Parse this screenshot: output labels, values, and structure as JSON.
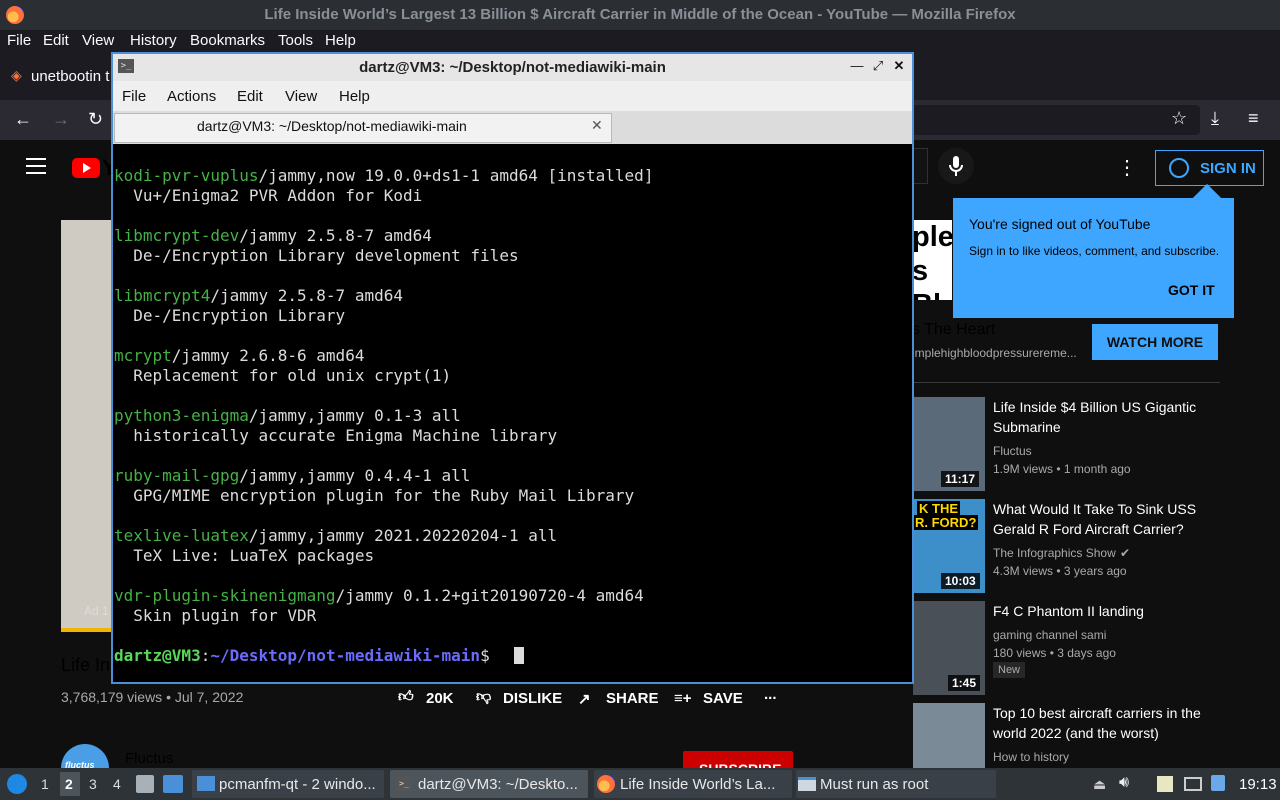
{
  "firefox": {
    "window_title": "Life Inside World’s Largest 13 Billion $ Aircraft Carrier in Middle of the Ocean - YouTube — Mozilla Firefox",
    "menu": [
      "File",
      "Edit",
      "View",
      "History",
      "Bookmarks",
      "Tools",
      "Help"
    ],
    "tab_label": "unetbootin t"
  },
  "youtube": {
    "logo_partial": "Y",
    "sign_in": "SIGN IN",
    "ad_label": "Ad 1",
    "video_title_partial": "Life In",
    "views": "3,768,179 views • Jul 7, 2022",
    "actions": {
      "like": "20K",
      "dislike": "DISLIKE",
      "share": "SHARE",
      "save": "SAVE",
      "more": "..."
    },
    "channel": "Fluctus",
    "avatar_text": "fluctus",
    "subscribe": "SUBSCRIBE",
    "ad": {
      "thumb_line1": "ple",
      "thumb_line2": "s Bl",
      "text": "s The Heart",
      "url": "implehighbloodpressureremе...",
      "button": "WATCH MORE"
    },
    "tooltip": {
      "title": "You're signed out of YouTube",
      "body": "Sign in to like videos, comment, and subscribe.",
      "button": "GOT IT"
    },
    "suggestions": [
      {
        "title": "Life Inside $4 Billion US Gigantic Submarine",
        "channel": "Fluctus",
        "meta": "1.9M views • 1 month ago",
        "duration": "11:17",
        "thumb_color": "#5a6a78"
      },
      {
        "title": "What Would It Take To Sink USS Gerald R Ford Aircraft Carrier?",
        "channel": "The Infographics Show",
        "meta": "4.3M views • 3 years ago",
        "duration": "10:03",
        "thumb_color": "#3d8fc9",
        "thumb_text_1": "K THE",
        "thumb_text_2": "R. FORD?"
      },
      {
        "title": "F4 C Phantom II landing",
        "channel": "gaming channel sami",
        "meta": "180 views • 3 days ago",
        "duration": "1:45",
        "badge": "New",
        "thumb_color": "#4a5058"
      },
      {
        "title": "Top 10 best aircraft carriers in the world 2022 (and the worst)",
        "channel": "How to history",
        "meta": "",
        "duration": "",
        "thumb_color": "#7a8a96"
      }
    ]
  },
  "terminal": {
    "title": "dartz@VM3: ~/Desktop/not-mediawiki-main",
    "menu": [
      "File",
      "Actions",
      "Edit",
      "View",
      "Help"
    ],
    "tab": "dartz@VM3: ~/Desktop/not-mediawiki-main",
    "tab_close": "✕",
    "lines": [
      {
        "pkg": "kodi-pvr-vuplus",
        "rest": "/jammy,now 19.0.0+ds1-1 amd64 [installed]",
        "desc": "  Vu+/Enigma2 PVR Addon for Kodi"
      },
      {
        "pkg": "libmcrypt-dev",
        "rest": "/jammy 2.5.8-7 amd64",
        "desc": "  De-/Encryption Library development files"
      },
      {
        "pkg": "libmcrypt4",
        "rest": "/jammy 2.5.8-7 amd64",
        "desc": "  De-/Encryption Library"
      },
      {
        "pkg": "mcrypt",
        "rest": "/jammy 2.6.8-6 amd64",
        "desc": "  Replacement for old unix crypt(1)"
      },
      {
        "pkg": "python3-enigma",
        "rest": "/jammy,jammy 0.1-3 all",
        "desc": "  historically accurate Enigma Machine library"
      },
      {
        "pkg": "ruby-mail-gpg",
        "rest": "/jammy,jammy 0.4.4-1 all",
        "desc": "  GPG/MIME encryption plugin for the Ruby Mail Library"
      },
      {
        "pkg": "texlive-luatex",
        "rest": "/jammy,jammy 2021.20220204-1 all",
        "desc": "  TeX Live: LuaTeX packages"
      },
      {
        "pkg": "vdr-plugin-skinenigmang",
        "rest": "/jammy 0.1.2+git20190720-4 amd64",
        "desc": "  Skin plugin for VDR"
      }
    ],
    "prompt_user": "dartz@VM3",
    "prompt_sep": ":",
    "prompt_path": "~/Desktop/not-mediawiki-main",
    "prompt_end": "$ "
  },
  "taskbar": {
    "workspaces": [
      "1",
      "2",
      "3",
      "4"
    ],
    "tasks": [
      "pcmanfm-qt - 2 windo...",
      "dartz@VM3: ~/Deskto...",
      "Life Inside World’s La...",
      "Must run as root"
    ],
    "clock": "19:13"
  }
}
